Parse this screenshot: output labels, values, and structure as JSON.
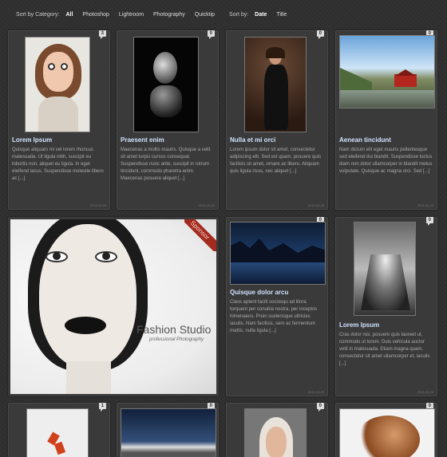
{
  "filter": {
    "category_label": "Sort by Category:",
    "categories": [
      "All",
      "Photoshop",
      "Lightroom",
      "Photography",
      "Quicktip"
    ],
    "sort_label": "Sort by:",
    "sort_options": [
      "Date",
      "Title"
    ]
  },
  "cards": [
    {
      "title": "Lorem Ipsum",
      "comments": "3",
      "excerpt": "Quisque aliquam mi vel lorem rhoncus malesuada. Ut ligula nibh, suscipit eu lobortis non, aliquet eu ligula. In eget eleifend lacus. Suspendisse molestie libero ac [...]",
      "date": "2013-10-29"
    },
    {
      "title": "Praesent enim",
      "comments": "0",
      "excerpt": "Maecenas a mollis mauris. Quisque a velit sit amet turpis cursus consequat. Suspendisse nunc ante, suscipit in rutrum tincidunt, commodo pharetra enim. Maecenas posuere aliquet [...]",
      "date": "2013-10-29"
    },
    {
      "title": "Nulla et mi orci",
      "comments": "0",
      "excerpt": "Lorem ipsum dolor sit amet, consectetur adipiscing elit. Sed est quam, posuere quis facilisis sit amet, ornare ac libero. Aliquam quis ligula risus, nec aliquet [...]",
      "date": "2013-10-29"
    },
    {
      "title": "Aenean tincidunt",
      "comments": "0",
      "excerpt": "Nam dictum elit eget mauris pellentesque sed eleifend dui blandit. Suspendisse luctus diam non dolor ullamcorper in blandit metus vulputate. Quisque ac magna orci. Sed [...]",
      "date": "2013-10-29"
    },
    {
      "title": "Quisque dolor arcu",
      "comments": "0",
      "excerpt": "Class aptent taciti sociosqu ad litora torquent per conubia nostra, per inceptos himenaeos. Proin scelerisque ultricies iaculis. Nam facilisis, sem ac fermentum mattis, nulla ligula [...]",
      "date": "2013-10-29"
    },
    {
      "title": "Lorem Ipsum",
      "comments": "0",
      "excerpt": "Cras dolor nisi, posuere quis laoreet ut, commodo ut lorem. Duis vehicula auctor velit in malesuada. Etiam magna quam, consectetur sit amet ullamcorper et, iaculis [...]",
      "date": "2013-10-29"
    }
  ],
  "bottom_badges": [
    "1",
    "0",
    "0",
    "0"
  ],
  "sponsor": {
    "label": "Sponsor",
    "caption": "Fashion Studio",
    "subcaption": "professional Photography"
  }
}
